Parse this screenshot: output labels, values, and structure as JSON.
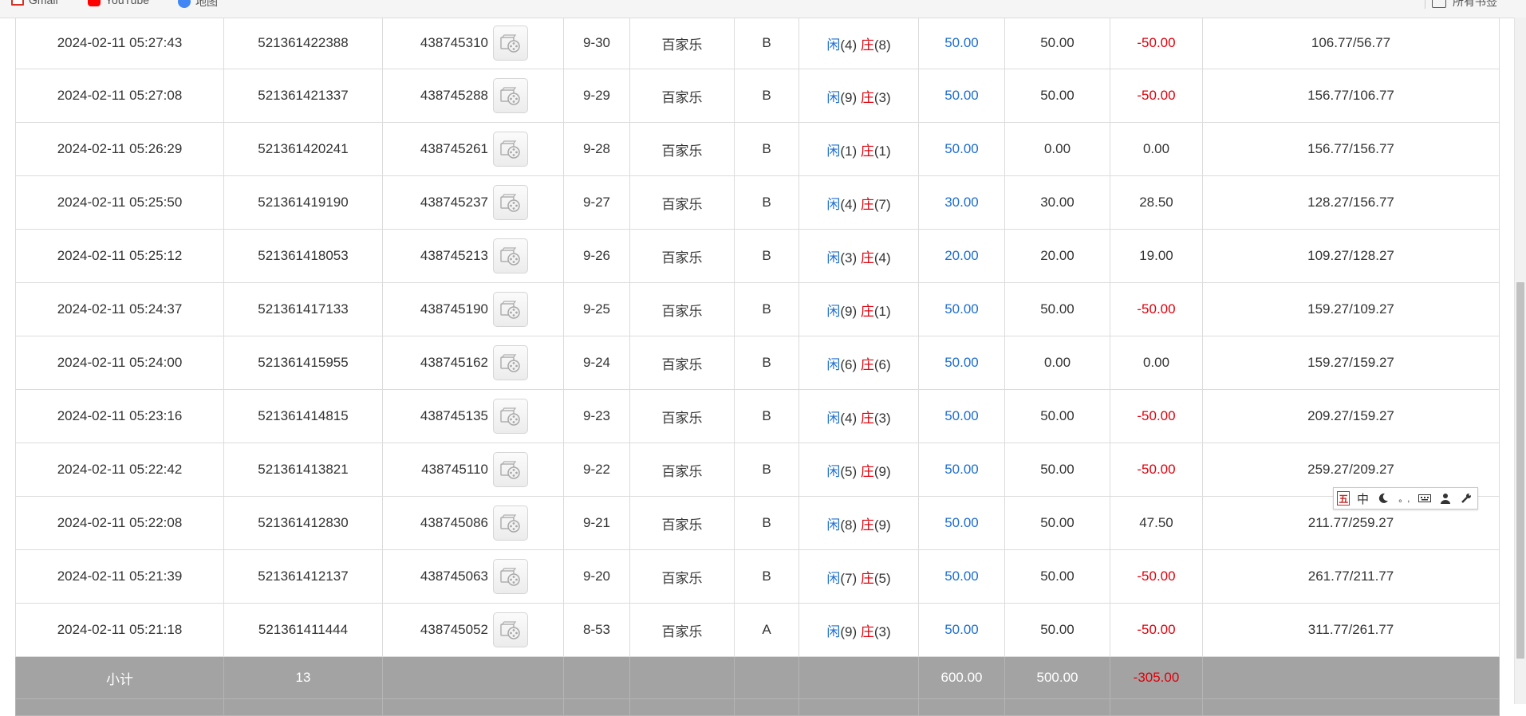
{
  "bookmarks": {
    "gmail": "Gmail",
    "youtube": "YouTube",
    "maps": "地图",
    "all_bookmarks": "所有书签"
  },
  "colors": {
    "player": "#1e6fd1",
    "banker": "#e0000b",
    "loss": "#e0000b",
    "subtotal_bg": "#a3a3a3"
  },
  "rows": [
    {
      "time": "2024-02-11 05:27:43",
      "order": "521361422388",
      "round": "438745310",
      "shoe": "9-30",
      "game": "百家乐",
      "table": "B",
      "p_label": "闲",
      "p_val": "(4)",
      "b_label": "庄",
      "b_val": "(8)",
      "bet": "50.00",
      "valid": "50.00",
      "win": "-50.00",
      "neg": true,
      "balance": "106.77/56.77"
    },
    {
      "time": "2024-02-11 05:27:08",
      "order": "521361421337",
      "round": "438745288",
      "shoe": "9-29",
      "game": "百家乐",
      "table": "B",
      "p_label": "闲",
      "p_val": "(9)",
      "b_label": "庄",
      "b_val": "(3)",
      "bet": "50.00",
      "valid": "50.00",
      "win": "-50.00",
      "neg": true,
      "balance": "156.77/106.77"
    },
    {
      "time": "2024-02-11 05:26:29",
      "order": "521361420241",
      "round": "438745261",
      "shoe": "9-28",
      "game": "百家乐",
      "table": "B",
      "p_label": "闲",
      "p_val": "(1)",
      "b_label": "庄",
      "b_val": "(1)",
      "bet": "50.00",
      "valid": "0.00",
      "win": "0.00",
      "neg": false,
      "balance": "156.77/156.77"
    },
    {
      "time": "2024-02-11 05:25:50",
      "order": "521361419190",
      "round": "438745237",
      "shoe": "9-27",
      "game": "百家乐",
      "table": "B",
      "p_label": "闲",
      "p_val": "(4)",
      "b_label": "庄",
      "b_val": "(7)",
      "bet": "30.00",
      "valid": "30.00",
      "win": "28.50",
      "neg": false,
      "balance": "128.27/156.77"
    },
    {
      "time": "2024-02-11 05:25:12",
      "order": "521361418053",
      "round": "438745213",
      "shoe": "9-26",
      "game": "百家乐",
      "table": "B",
      "p_label": "闲",
      "p_val": "(3)",
      "b_label": "庄",
      "b_val": "(4)",
      "bet": "20.00",
      "valid": "20.00",
      "win": "19.00",
      "neg": false,
      "balance": "109.27/128.27"
    },
    {
      "time": "2024-02-11 05:24:37",
      "order": "521361417133",
      "round": "438745190",
      "shoe": "9-25",
      "game": "百家乐",
      "table": "B",
      "p_label": "闲",
      "p_val": "(9)",
      "b_label": "庄",
      "b_val": "(1)",
      "bet": "50.00",
      "valid": "50.00",
      "win": "-50.00",
      "neg": true,
      "balance": "159.27/109.27"
    },
    {
      "time": "2024-02-11 05:24:00",
      "order": "521361415955",
      "round": "438745162",
      "shoe": "9-24",
      "game": "百家乐",
      "table": "B",
      "p_label": "闲",
      "p_val": "(6)",
      "b_label": "庄",
      "b_val": "(6)",
      "bet": "50.00",
      "valid": "0.00",
      "win": "0.00",
      "neg": false,
      "balance": "159.27/159.27"
    },
    {
      "time": "2024-02-11 05:23:16",
      "order": "521361414815",
      "round": "438745135",
      "shoe": "9-23",
      "game": "百家乐",
      "table": "B",
      "p_label": "闲",
      "p_val": "(4)",
      "b_label": "庄",
      "b_val": "(3)",
      "bet": "50.00",
      "valid": "50.00",
      "win": "-50.00",
      "neg": true,
      "balance": "209.27/159.27"
    },
    {
      "time": "2024-02-11 05:22:42",
      "order": "521361413821",
      "round": "438745110",
      "shoe": "9-22",
      "game": "百家乐",
      "table": "B",
      "p_label": "闲",
      "p_val": "(5)",
      "b_label": "庄",
      "b_val": "(9)",
      "bet": "50.00",
      "valid": "50.00",
      "win": "-50.00",
      "neg": true,
      "balance": "259.27/209.27"
    },
    {
      "time": "2024-02-11 05:22:08",
      "order": "521361412830",
      "round": "438745086",
      "shoe": "9-21",
      "game": "百家乐",
      "table": "B",
      "p_label": "闲",
      "p_val": "(8)",
      "b_label": "庄",
      "b_val": "(9)",
      "bet": "50.00",
      "valid": "50.00",
      "win": "47.50",
      "neg": false,
      "balance": "211.77/259.27"
    },
    {
      "time": "2024-02-11 05:21:39",
      "order": "521361412137",
      "round": "438745063",
      "shoe": "9-20",
      "game": "百家乐",
      "table": "B",
      "p_label": "闲",
      "p_val": "(7)",
      "b_label": "庄",
      "b_val": "(5)",
      "bet": "50.00",
      "valid": "50.00",
      "win": "-50.00",
      "neg": true,
      "balance": "261.77/211.77"
    },
    {
      "time": "2024-02-11 05:21:18",
      "order": "521361411444",
      "round": "438745052",
      "shoe": "8-53",
      "game": "百家乐",
      "table": "A",
      "p_label": "闲",
      "p_val": "(9)",
      "b_label": "庄",
      "b_val": "(3)",
      "bet": "50.00",
      "valid": "50.00",
      "win": "-50.00",
      "neg": true,
      "balance": "311.77/261.77"
    }
  ],
  "subtotal": {
    "label": "小计",
    "count": "13",
    "bet": "600.00",
    "valid": "500.00",
    "win": "-305.00"
  },
  "ime": {
    "logo": "五",
    "mode": "中",
    "width_icon": "moon-icon",
    "punct": "。,",
    "keyboard_icon": "keyboard-icon",
    "user_icon": "user-icon",
    "settings_icon": "wrench-icon"
  }
}
